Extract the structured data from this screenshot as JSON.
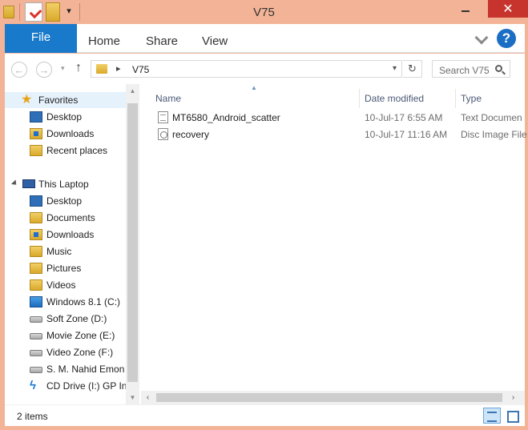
{
  "window": {
    "title": "V75",
    "close_glyph": "✕"
  },
  "ribbon": {
    "tabs": {
      "file": "File",
      "home": "Home",
      "share": "Share",
      "view": "View"
    },
    "help_glyph": "?"
  },
  "address": {
    "path": "V75",
    "separator": "▸"
  },
  "search": {
    "placeholder": "Search V75"
  },
  "navpane": {
    "favorites": {
      "label": "Favorites",
      "items": [
        "Desktop",
        "Downloads",
        "Recent places"
      ]
    },
    "this_laptop": {
      "label": "This Laptop",
      "items": [
        "Desktop",
        "Documents",
        "Downloads",
        "Music",
        "Pictures",
        "Videos",
        "Windows 8.1 (C:)",
        "Soft Zone (D:)",
        "Movie Zone (E:)",
        "Video Zone (F:)",
        "S. M. Nahid Emon",
        "CD Drive (I:) GP Int"
      ]
    }
  },
  "columns": {
    "name": "Name",
    "date": "Date modified",
    "type": "Type"
  },
  "files": [
    {
      "name": "MT6580_Android_scatter",
      "date": "10-Jul-17 6:55 AM",
      "type": "Text Documen",
      "icon": "text-file-icon"
    },
    {
      "name": "recovery",
      "date": "10-Jul-17 11:16 AM",
      "type": "Disc Image File",
      "icon": "disc-image-icon"
    }
  ],
  "status": {
    "item_count": "2 items"
  },
  "colors": {
    "title_bar": "#f3b396",
    "file_tab": "#1979ca",
    "close_button": "#c7342d",
    "selection": "#e5f1fb"
  }
}
